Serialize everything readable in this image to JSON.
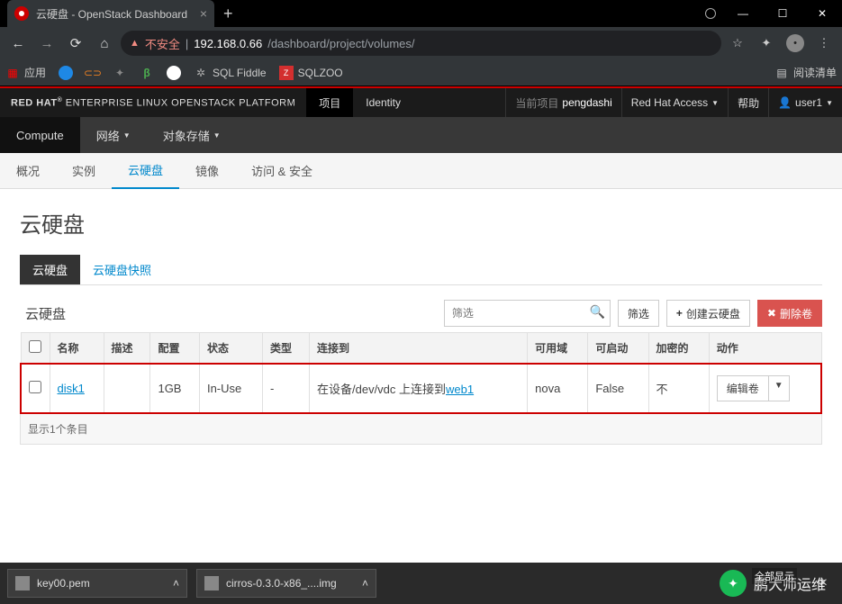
{
  "browser": {
    "tab_title": "云硬盘 - OpenStack Dashboard",
    "url_warn": "不安全",
    "url_host": "192.168.0.66",
    "url_path": "/dashboard/project/volumes/"
  },
  "bookmarks": {
    "apps": "应用",
    "sqlfiddle": "SQL Fiddle",
    "sqlzoo": "SQLZOO",
    "readlist": "阅读清单"
  },
  "rh": {
    "logo1": "RED HAT",
    "logo2": " ENTERPRISE LINUX OPENSTACK PLATFORM",
    "proj": "项目",
    "identity": "Identity",
    "curproj_lbl": "当前项目",
    "curproj_val": "pengdashi",
    "access": "Red Hat Access ",
    "help": "帮助",
    "user": "user1 "
  },
  "nav2": {
    "compute": "Compute",
    "network": "网络 ",
    "object": "对象存储 "
  },
  "nav3": {
    "overview": "概况",
    "instances": "实例",
    "volumes": "云硬盘",
    "images": "镜像",
    "access": "访问 & 安全"
  },
  "page": {
    "title": "云硬盘"
  },
  "subtabs": {
    "vol": "云硬盘",
    "snap": "云硬盘快照"
  },
  "toolbar": {
    "tbl_title": "云硬盘",
    "filter_ph": "筛选",
    "filter_btn": "筛选",
    "create": "创建云硬盘",
    "delete": "删除卷"
  },
  "columns": {
    "name": "名称",
    "desc": "描述",
    "size": "配置",
    "status": "状态",
    "type": "类型",
    "attach": "连接到",
    "zone": "可用域",
    "boot": "可启动",
    "enc": "加密的",
    "actions": "动作"
  },
  "row": {
    "name": "disk1",
    "desc": "",
    "size": "1GB",
    "status": "In-Use",
    "type": "-",
    "attach_pre": "在设备/dev/vdc 上连接到",
    "attach_link": "web1",
    "zone": "nova",
    "boot": "False",
    "enc": "不",
    "action": "编辑卷"
  },
  "footer": "显示1个条目",
  "downloads": {
    "f1": "key00.pem",
    "f2": "cirros-0.3.0-x86_....img",
    "showall": "全部显示"
  },
  "watermark": "鹏大师运维"
}
